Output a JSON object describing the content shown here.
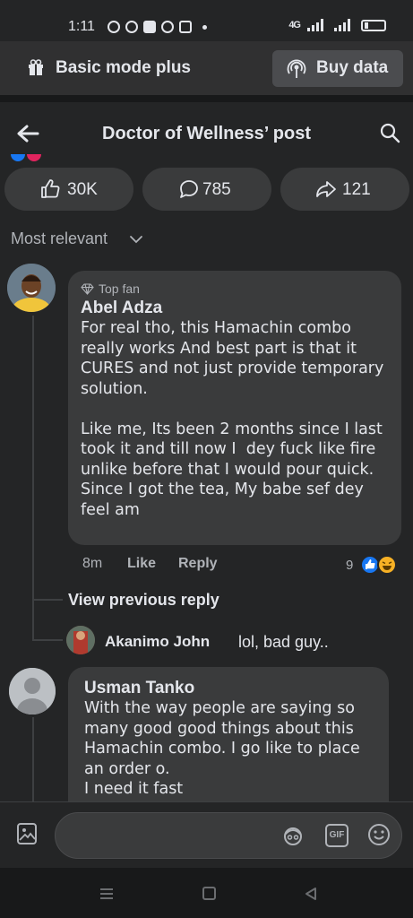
{
  "status_bar": {
    "time": "1:11",
    "network": "4G"
  },
  "basic_mode": {
    "label": "Basic mode plus",
    "buy_label": "Buy data"
  },
  "header": {
    "title": "Doctor of Wellness’ post"
  },
  "actions": {
    "likes": "30K",
    "comments": "785",
    "shares": "121"
  },
  "sort": {
    "label": "Most relevant"
  },
  "comments": [
    {
      "badge": "Top fan",
      "author": "Abel Adza",
      "text": "For real tho, this Hamachin combo really works And best part is that it CURES and not just provide temporary solution.\n\nLike me, Its been 2 months since I last took it and till now I  dey fuck like fire  unlike before that I would pour quick.\nSince I got the tea, My babe sef dey feel am",
      "time": "8m",
      "like_label": "Like",
      "reply_label": "Reply",
      "reaction_count": "9",
      "view_previous": "View previous reply",
      "reply": {
        "author": "Akanimo John",
        "text": "lol, bad guy.."
      }
    },
    {
      "author": "Usman Tanko",
      "text": "With the way people are saying so many good good things about this Hamachin combo. I go like to place an order o.\nI need it fast"
    }
  ],
  "composer": {
    "placeholder": "",
    "gif_label": "GIF"
  },
  "colors": {
    "background": "#242526",
    "bubble": "#3a3b3c",
    "like_blue": "#1877f2",
    "haha_yellow": "#f7b125"
  }
}
